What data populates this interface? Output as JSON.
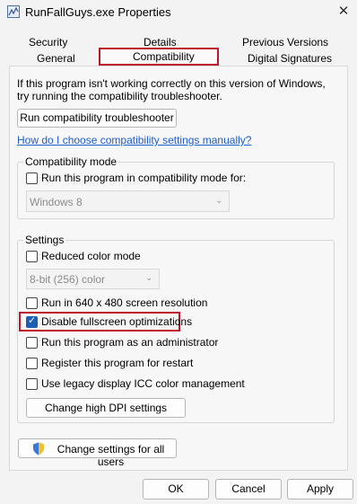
{
  "window": {
    "title": "RunFallGuys.exe Properties",
    "close_glyph": "✕",
    "app_icon": "chart-app-icon"
  },
  "tabs": {
    "row1": [
      "Security",
      "Details",
      "Previous Versions"
    ],
    "row2": [
      "General",
      "Compatibility",
      "Digital Signatures"
    ],
    "active": "Compatibility"
  },
  "intro": {
    "line1": "If this program isn't working correctly on this version of Windows,",
    "line2": "try running the compatibility troubleshooter."
  },
  "buttons": {
    "troubleshooter": "Run compatibility troubleshooter",
    "high_dpi": "Change high DPI settings",
    "all_users": "Change settings for all users",
    "ok": "OK",
    "cancel": "Cancel",
    "apply": "Apply"
  },
  "help_link": "How do I choose compatibility settings manually?",
  "compat_mode": {
    "legend": "Compatibility mode",
    "checkbox_label": "Run this program in compatibility mode for:",
    "checked": false,
    "selected_os": "Windows 8"
  },
  "settings": {
    "legend": "Settings",
    "reduced_color": {
      "label": "Reduced color mode",
      "checked": false
    },
    "color_select": "8-bit (256) color",
    "run_640": {
      "label": "Run in 640 x 480 screen resolution",
      "checked": false
    },
    "disable_fullscreen": {
      "label": "Disable fullscreen optimizations",
      "checked": true
    },
    "run_admin": {
      "label": "Run this program as an administrator",
      "checked": false
    },
    "register_restart": {
      "label": "Register this program for restart",
      "checked": false
    },
    "legacy_icc": {
      "label": "Use legacy display ICC color management",
      "checked": false
    }
  },
  "colors": {
    "highlight": "#c0162b",
    "link": "#1e5cc8",
    "checkbox_checked": "#1a5fb4"
  }
}
